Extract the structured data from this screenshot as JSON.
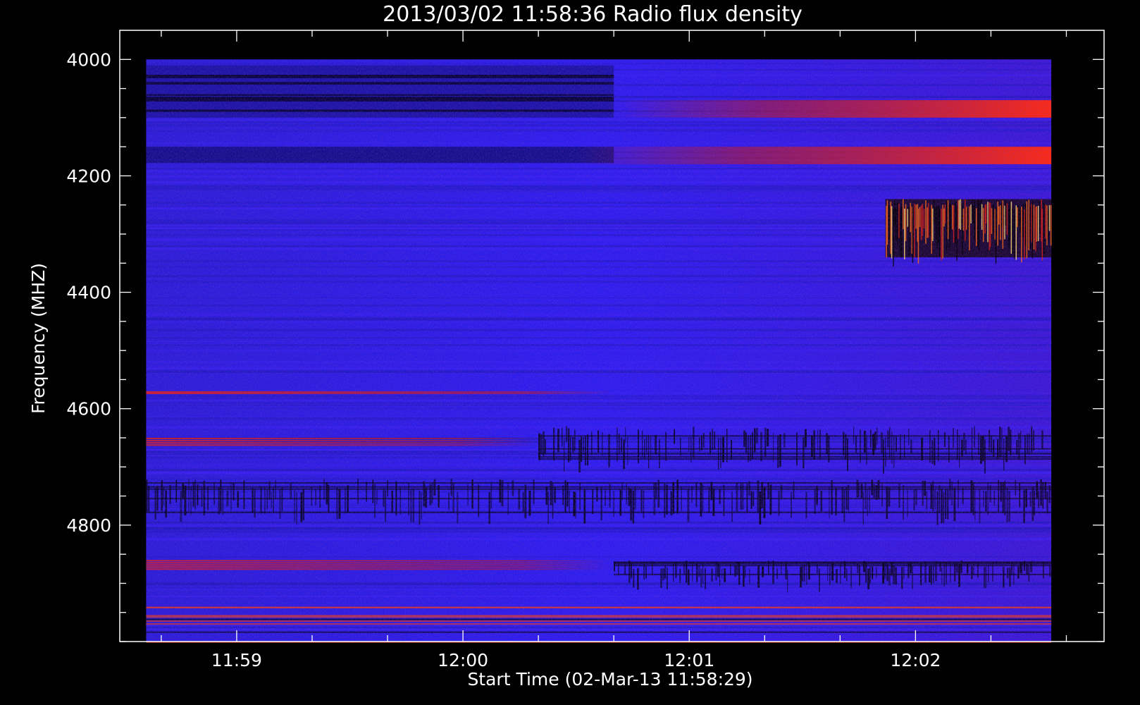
{
  "chart_data": {
    "type": "heatmap",
    "title": "2013/03/02 11:58:36 Radio flux density",
    "xlabel": "Start Time (02-Mar-13 11:58:29)",
    "ylabel": "Frequency (MHZ)",
    "x_ticks": [
      "11:59",
      "12:00",
      "12:01",
      "12:02"
    ],
    "y_ticks": [
      "4000",
      "4200",
      "4400",
      "4600",
      "4800"
    ],
    "y_tick_values": [
      4000,
      4200,
      4400,
      4600,
      4800
    ],
    "xlim": [
      "11:58:29",
      "12:02:50"
    ],
    "ylim": [
      3950,
      5000
    ],
    "data_extent": {
      "time_start": "11:58:36",
      "time_end": "12:02:36",
      "freq_min_mhz": 4000,
      "freq_max_mhz": 5000
    },
    "colormap": [
      "#000000",
      "#1a1aa0",
      "#2b18e8",
      "#c81818",
      "#ff2a10",
      "#ffe080"
    ],
    "features": [
      {
        "label": "dark bands",
        "freq_mhz": [
          4010,
          4100
        ],
        "time": [
          "11:58:36",
          "12:00:40"
        ]
      },
      {
        "label": "red bands",
        "freq_mhz": [
          4070,
          4100
        ],
        "time": [
          "12:00:40",
          "12:02:36"
        ]
      },
      {
        "label": "red bands",
        "freq_mhz": [
          4150,
          4180
        ],
        "time": [
          "12:00:30",
          "12:02:36"
        ]
      },
      {
        "label": "burst",
        "freq_mhz": [
          4240,
          4340
        ],
        "time": [
          "12:01:52",
          "12:02:36"
        ]
      },
      {
        "label": "red lines",
        "freq_mhz": [
          4570,
          4575
        ],
        "time": [
          "11:58:36",
          "12:00:40"
        ]
      },
      {
        "label": "red lines",
        "freq_mhz": [
          4650,
          4665
        ],
        "time": [
          "11:58:36",
          "12:00:20"
        ]
      },
      {
        "label": "noise band",
        "freq_mhz": [
          4630,
          4690
        ],
        "time": [
          "12:00:20",
          "12:02:36"
        ]
      },
      {
        "label": "noise band",
        "freq_mhz": [
          4720,
          4780
        ],
        "time": [
          "11:58:36",
          "12:02:36"
        ]
      },
      {
        "label": "red lines",
        "freq_mhz": [
          4860,
          4878
        ],
        "time": [
          "11:58:36",
          "12:00:40"
        ]
      },
      {
        "label": "dark lines",
        "freq_mhz": [
          4860,
          4900
        ],
        "time": [
          "12:00:40",
          "12:02:36"
        ]
      },
      {
        "label": "speckle lines",
        "freq_mhz": [
          4940,
          5000
        ],
        "time": [
          "11:58:36",
          "12:02:36"
        ]
      }
    ]
  }
}
